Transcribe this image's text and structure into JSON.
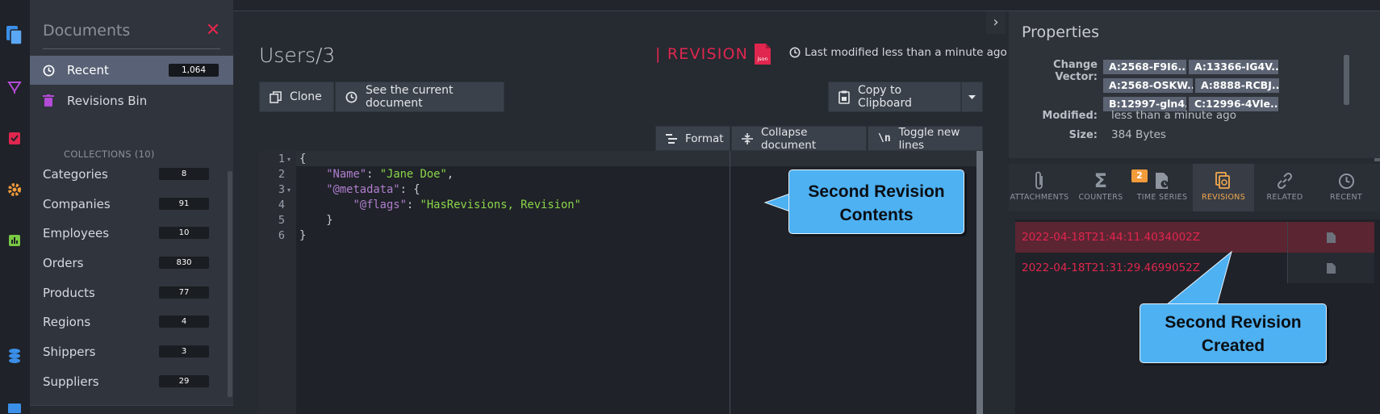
{
  "sidebar_rail": {
    "icons": [
      "documents-icon",
      "indexes-icon",
      "tasks-icon",
      "settings-icon",
      "stats-icon",
      "databases-icon",
      "manage-server-icon"
    ]
  },
  "documents_panel": {
    "title": "Documents",
    "nav": [
      {
        "label": "Recent",
        "count": "1,064"
      },
      {
        "label": "Revisions Bin"
      }
    ],
    "collections_header": "COLLECTIONS (10)",
    "collections": [
      {
        "name": "Categories",
        "count": "8"
      },
      {
        "name": "Companies",
        "count": "91"
      },
      {
        "name": "Employees",
        "count": "10"
      },
      {
        "name": "Orders",
        "count": "830"
      },
      {
        "name": "Products",
        "count": "77"
      },
      {
        "name": "Regions",
        "count": "4"
      },
      {
        "name": "Shippers",
        "count": "3"
      },
      {
        "name": "Suppliers",
        "count": "29"
      }
    ]
  },
  "main": {
    "title": "Users/3",
    "revision_label": "| REVISION",
    "json_badge": "json",
    "last_modified": "Last modified less than a minute ago",
    "buttons": {
      "clone": "Clone",
      "see_current": "See the current document",
      "copy": "Copy to Clipboard",
      "format": "Format",
      "collapse": "Collapse document",
      "toggle": "Toggle new lines"
    },
    "editor": {
      "line_numbers": [
        "1",
        "2",
        "3",
        "4",
        "5",
        "6"
      ],
      "lines": [
        [
          {
            "t": "{",
            "c": "p"
          }
        ],
        [
          {
            "t": "    ",
            "c": "p"
          },
          {
            "t": "\"Name\"",
            "c": "k"
          },
          {
            "t": ": ",
            "c": "p"
          },
          {
            "t": "\"Jane Doe\"",
            "c": "s"
          },
          {
            "t": ",",
            "c": "p"
          }
        ],
        [
          {
            "t": "    ",
            "c": "p"
          },
          {
            "t": "\"@metadata\"",
            "c": "k"
          },
          {
            "t": ": {",
            "c": "p"
          }
        ],
        [
          {
            "t": "        ",
            "c": "p"
          },
          {
            "t": "\"@flags\"",
            "c": "k"
          },
          {
            "t": ": ",
            "c": "p"
          },
          {
            "t": "\"HasRevisions, Revision\"",
            "c": "s"
          }
        ],
        [
          {
            "t": "    }",
            "c": "p"
          }
        ],
        [
          {
            "t": "}",
            "c": "p"
          }
        ]
      ]
    }
  },
  "callouts": {
    "contents": [
      "Second Revision",
      "Contents"
    ],
    "created": [
      "Second Revision",
      "Created"
    ]
  },
  "properties": {
    "title": "Properties",
    "change_vector_label": "Change Vector:",
    "change_vectors": [
      "A:2568-F9I6...",
      "A:13366-IG4V...",
      "A:2568-OSKW...",
      "A:8888-RCBJ...",
      "B:12997-gln4...",
      "C:12996-4Vle..."
    ],
    "modified_label": "Modified:",
    "modified_value": "less than a minute ago",
    "size_label": "Size:",
    "size_value": "384 Bytes"
  },
  "tabs": [
    {
      "label": "ATTACHMENTS",
      "icon": "paperclip-icon"
    },
    {
      "label": "COUNTERS",
      "icon": "sigma-icon"
    },
    {
      "label": "TIME SERIES",
      "icon": "timeseries-icon"
    },
    {
      "label": "REVISIONS",
      "icon": "revisions-icon",
      "badge": "2",
      "active": true
    },
    {
      "label": "RELATED",
      "icon": "link-icon"
    },
    {
      "label": "RECENT",
      "icon": "clock-icon"
    }
  ],
  "revisions": [
    "2022-04-18T21:44:11.4034002Z",
    "2022-04-18T21:31:29.4699052Z"
  ],
  "colors": {
    "accent_red": "#e0264e",
    "callout_blue": "#4db1f2",
    "active_tab_orange": "#f2a84d"
  }
}
